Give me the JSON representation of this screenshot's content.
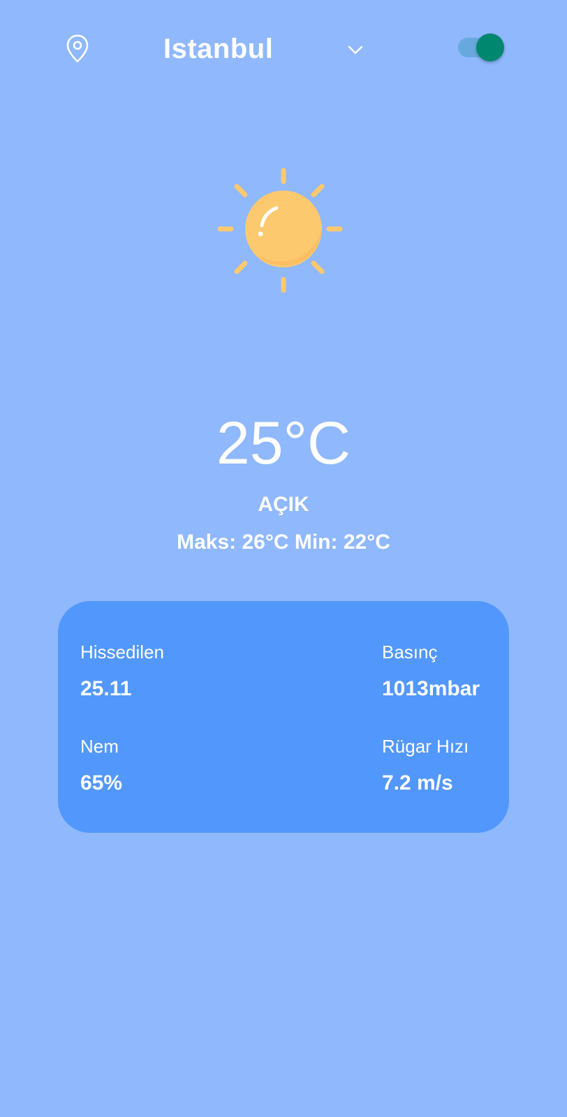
{
  "header": {
    "location_icon": "map-pin-icon",
    "city": "Istanbul",
    "dropdown_icon": "chevron-down-icon",
    "toggle_on": true
  },
  "weather": {
    "icon": "sun-icon",
    "temperature": "25°C",
    "condition": "AÇIK",
    "minmax": "Maks: 26°C Min: 22°C"
  },
  "details": {
    "feels_like": {
      "label": "Hissedilen",
      "value": "25.11"
    },
    "pressure": {
      "label": "Basınç",
      "value": "1013mbar"
    },
    "humidity": {
      "label": "Nem",
      "value": "65%"
    },
    "wind_speed": {
      "label": "Rügar Hızı",
      "value": "7.2 m/s"
    }
  },
  "colors": {
    "background": "#8fb8fd",
    "card": "#5297fc",
    "sun": "#fdc96f",
    "toggle_thumb": "#00876f",
    "toggle_track": "#67a9de",
    "text": "#ffffff"
  }
}
